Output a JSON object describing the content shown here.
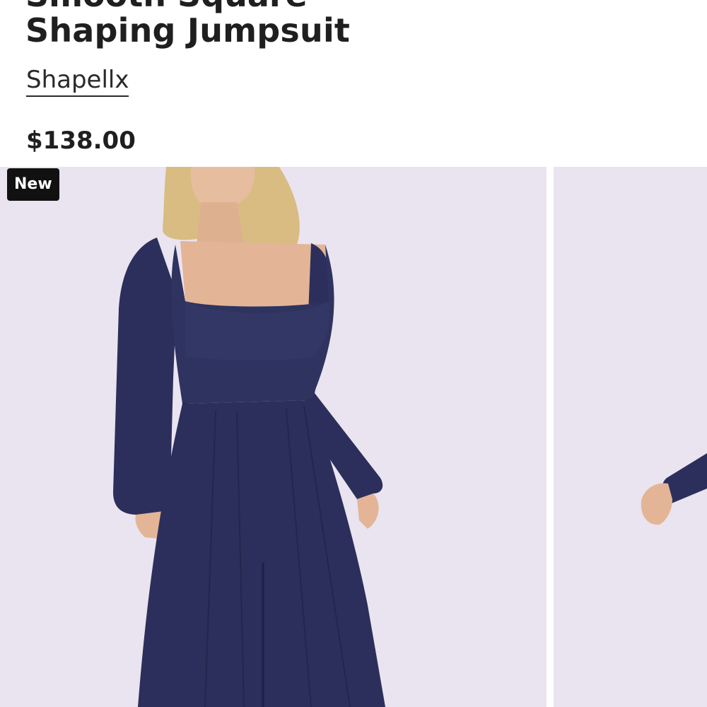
{
  "product": {
    "title_partial": "Smooth Square",
    "title": "Shaping Jumpsuit",
    "brand": "Shapellx",
    "price": "$138.00"
  },
  "gallery": {
    "badge": "New",
    "slides": [
      {
        "image": "model-front-navy-jumpsuit"
      },
      {
        "image": "model-side-navy-jumpsuit"
      }
    ]
  },
  "colors": {
    "background": "#ffffff",
    "photo_background": "#e9e4ef",
    "garment": "#2c2f5c",
    "badge": "#111111"
  }
}
